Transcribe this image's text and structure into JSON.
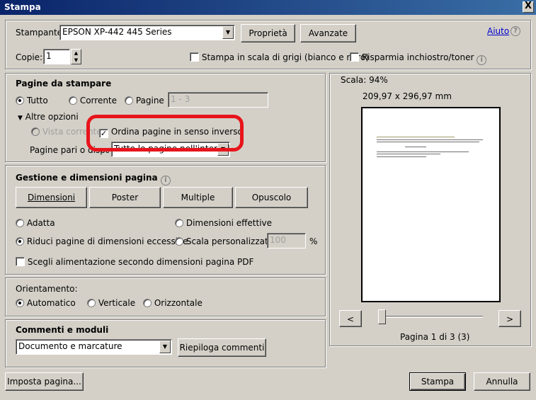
{
  "window": {
    "title": "Stampa",
    "close": "X"
  },
  "printer": {
    "label": "Stampante:",
    "selected": "EPSON XP-442 445 Series",
    "properties": "Proprietà",
    "advanced": "Avanzate",
    "help": "Aiuto",
    "help_icon": "?"
  },
  "copies": {
    "label": "Copie:",
    "value": "1",
    "grayscale": "Stampa in scala di grigi (bianco e nero)",
    "save_ink": "Risparmia inchiostro/toner",
    "info_icon": "i"
  },
  "pages": {
    "heading": "Pagine da stampare",
    "all": "Tutto",
    "current": "Corrente",
    "pages": "Pagine",
    "range": "1 - 3",
    "more_options": "Altre opzioni",
    "current_view": "Vista corrente",
    "reverse": "Ordina pagine in senso inverso",
    "odd_even_label": "Pagine pari o dispari:",
    "odd_even_value": "Tutte le pagine nell'intervallo"
  },
  "sizing": {
    "heading": "Gestione e dimensioni pagina",
    "info_icon": "i",
    "buttons": [
      "Dimensioni",
      "Poster",
      "Multiple",
      "Opuscolo"
    ],
    "fit": "Adatta",
    "actual_size": "Dimensioni effettive",
    "shrink": "Riduci pagine di dimensioni eccessive",
    "custom_scale": "Scala personalizzata:",
    "scale_value": "100",
    "percent": "%",
    "paper_source": "Scegli alimentazione secondo dimensioni pagina PDF"
  },
  "orientation": {
    "heading": "Orientamento:",
    "auto": "Automatico",
    "portrait": "Verticale",
    "landscape": "Orizzontale"
  },
  "comments": {
    "heading": "Commenti e moduli",
    "selected": "Documento e marcature",
    "summarize": "Riepiloga commenti"
  },
  "preview": {
    "scale": "Scala:  94%",
    "size": "209,97 x 296,97 mm",
    "prev": "<",
    "next": ">",
    "page_info": "Pagina 1 di 3 (3)"
  },
  "footer": {
    "page_setup": "Imposta pagina...",
    "print": "Stampa",
    "cancel": "Annulla"
  }
}
